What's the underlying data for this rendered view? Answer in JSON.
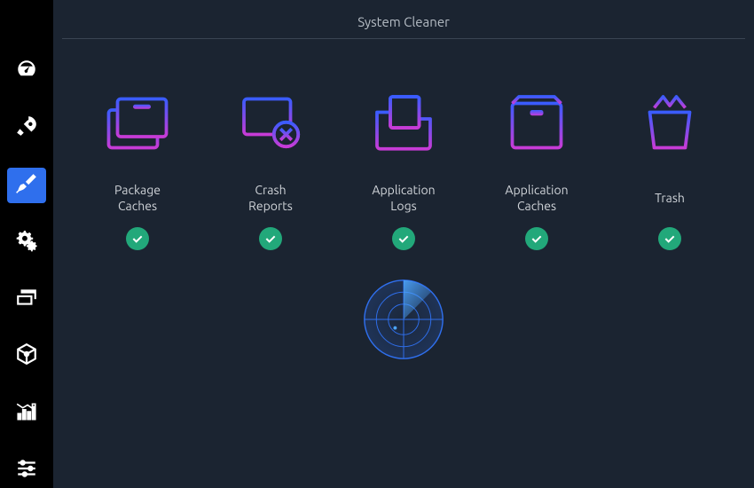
{
  "header": {
    "title": "System Cleaner"
  },
  "sidebar": {
    "items": [
      {
        "name": "dashboard",
        "icon": "gauge",
        "active": false
      },
      {
        "name": "startup",
        "icon": "rocket",
        "active": false
      },
      {
        "name": "cleaner",
        "icon": "broom",
        "active": true
      },
      {
        "name": "services",
        "icon": "gears",
        "active": false
      },
      {
        "name": "processes",
        "icon": "windows",
        "active": false
      },
      {
        "name": "packages",
        "icon": "package",
        "active": false
      },
      {
        "name": "resources",
        "icon": "chart",
        "active": false
      },
      {
        "name": "settings",
        "icon": "sliders",
        "active": false
      }
    ]
  },
  "cards": [
    {
      "id": "package-caches",
      "label": "Package\nCaches",
      "icon": "boxes",
      "checked": true
    },
    {
      "id": "crash-reports",
      "label": "Crash\nReports",
      "icon": "crash",
      "checked": true
    },
    {
      "id": "application-logs",
      "label": "Application\nLogs",
      "icon": "folder-log",
      "checked": true
    },
    {
      "id": "application-caches",
      "label": "Application\nCaches",
      "icon": "app-cache",
      "checked": true
    },
    {
      "id": "trash",
      "label": "Trash",
      "icon": "trash",
      "checked": true
    }
  ],
  "colors": {
    "accent": "#2f6fed",
    "grad_a": "#3a5cff",
    "grad_b": "#c83bd6",
    "check": "#22a87a"
  },
  "scan": {
    "label": "Scan"
  }
}
